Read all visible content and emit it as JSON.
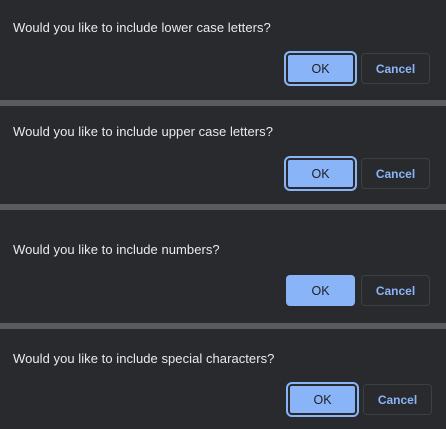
{
  "dialogs": [
    {
      "message": "Would you like to include lower case letters?",
      "ok_label": "OK",
      "cancel_label": "Cancel"
    },
    {
      "message": "Would you like to include upper case letters?",
      "ok_label": "OK",
      "cancel_label": "Cancel"
    },
    {
      "message": "Would you like to include numbers?",
      "ok_label": "OK",
      "cancel_label": "Cancel"
    },
    {
      "message": "Would you like to include special characters?",
      "ok_label": "OK",
      "cancel_label": "Cancel"
    }
  ],
  "colors": {
    "dialog_bg": "#292a2d",
    "separator": "#5a5b5e",
    "accent": "#8ab4f8",
    "text": "#e8eaed"
  }
}
